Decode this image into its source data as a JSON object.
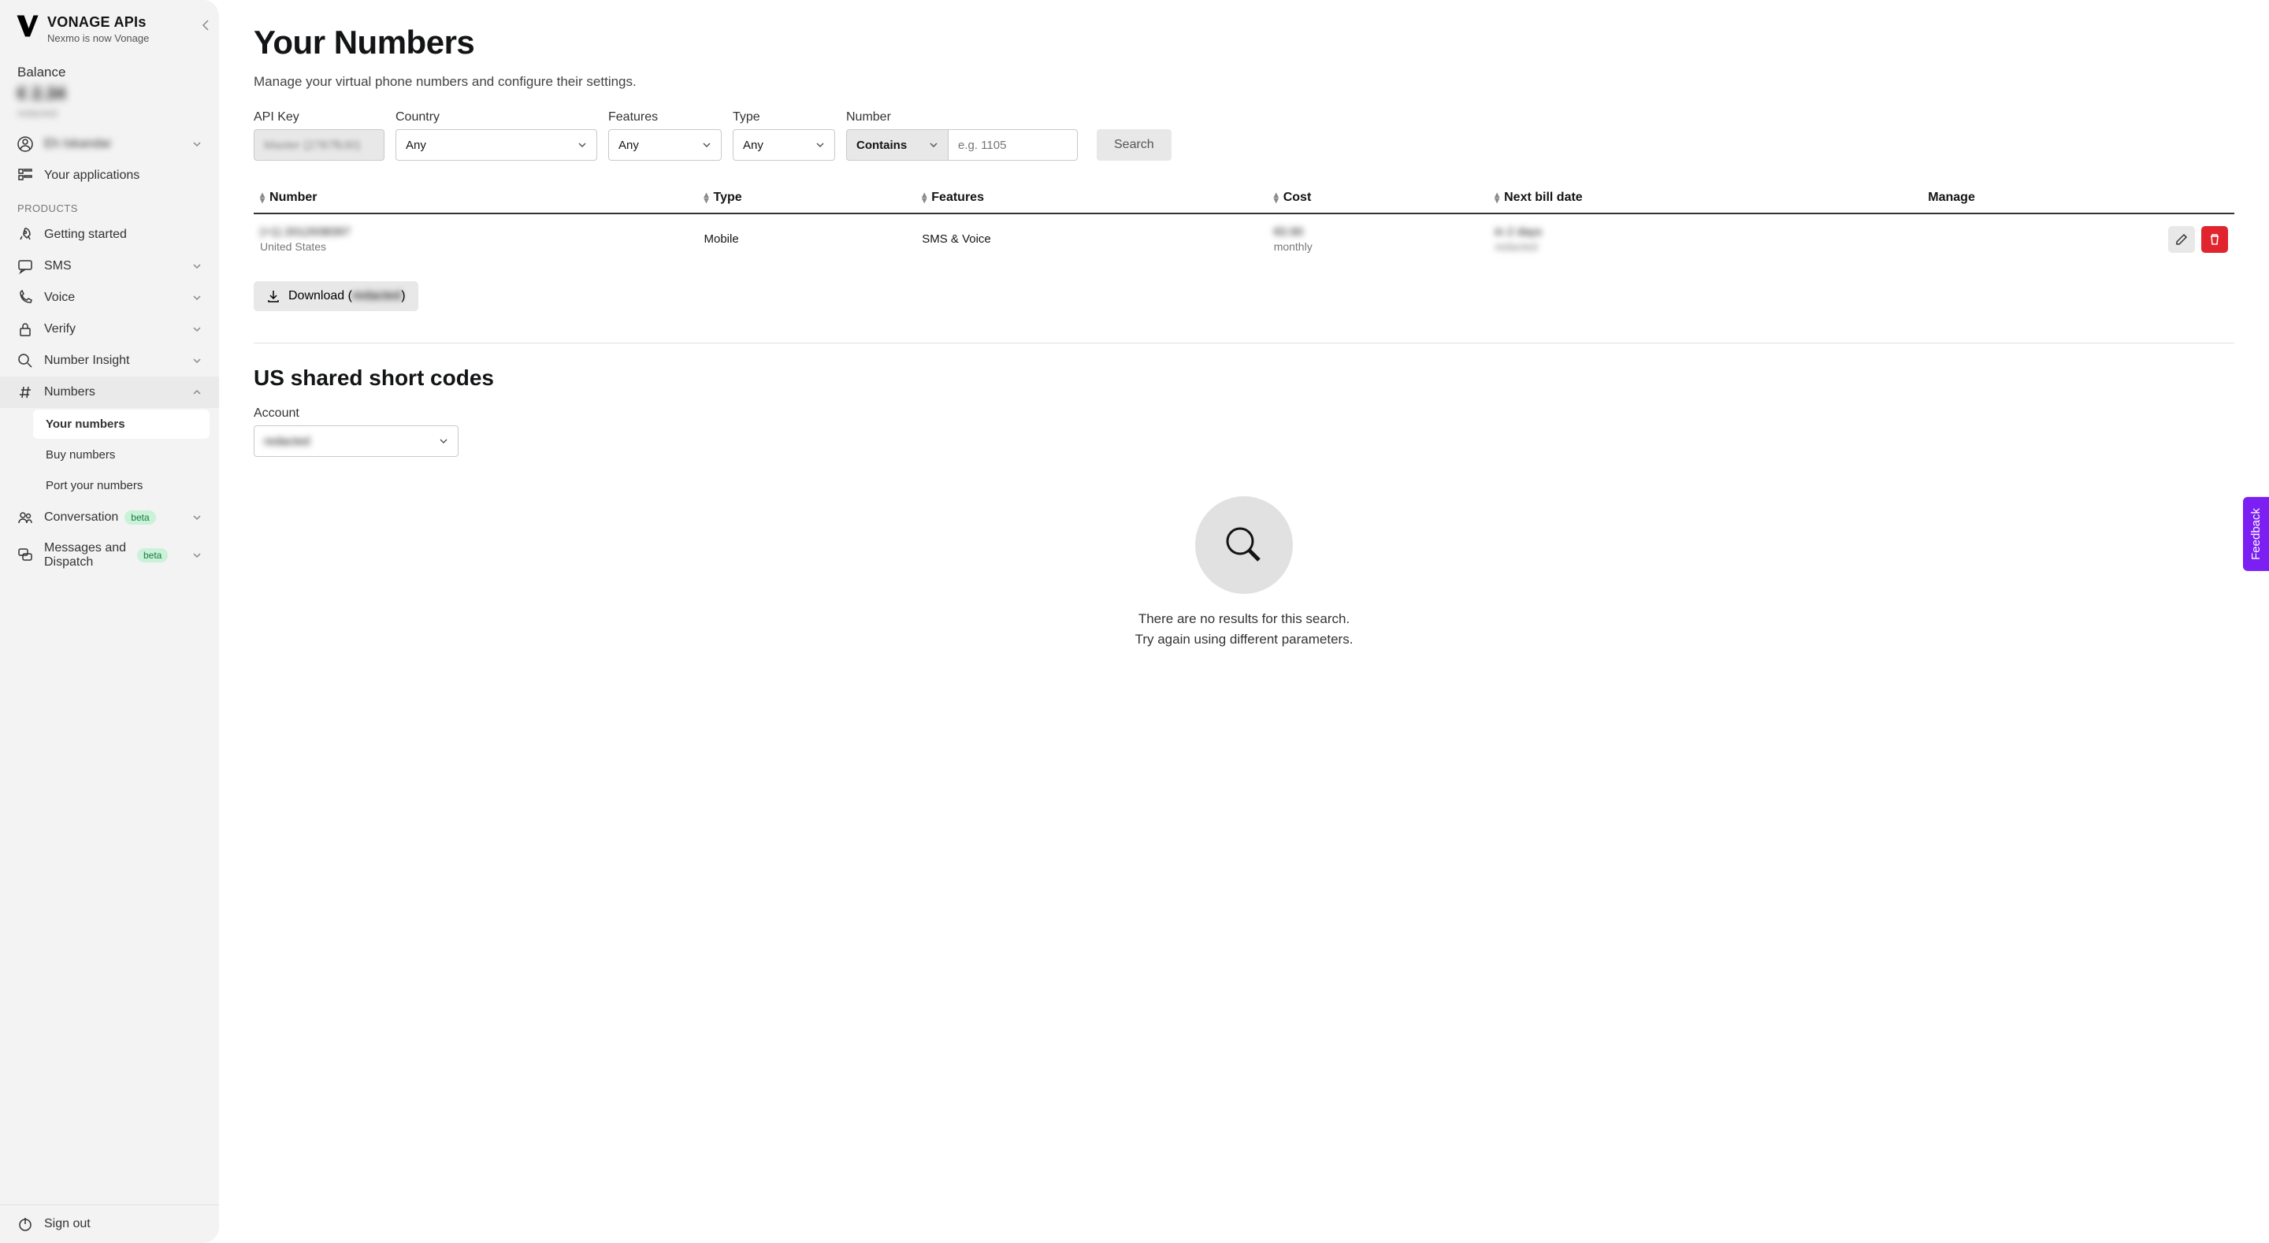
{
  "brand": {
    "title": "VONAGE APIs",
    "subtitle": "Nexmo is now Vonage"
  },
  "balance": {
    "label": "Balance",
    "amount": "€ 2.34",
    "sub": "redacted"
  },
  "user_item": "Eh Iskandar",
  "apps_item": "Your applications",
  "products_label": "PRODUCTS",
  "nav": {
    "getting_started": "Getting started",
    "sms": "SMS",
    "voice": "Voice",
    "verify": "Verify",
    "number_insight": "Number Insight",
    "numbers": "Numbers",
    "conversation": "Conversation",
    "messages_dispatch": "Messages and Dispatch",
    "sign_out": "Sign out"
  },
  "beta_label": "beta",
  "subnav": {
    "your_numbers": "Your numbers",
    "buy_numbers": "Buy numbers",
    "port_numbers": "Port your numbers"
  },
  "page": {
    "title": "Your Numbers",
    "desc": "Manage your virtual phone numbers and configure their settings."
  },
  "filters": {
    "api_key_label": "API Key",
    "api_key_value": "Master (2787fb30)",
    "country_label": "Country",
    "any": "Any",
    "features_label": "Features",
    "type_label": "Type",
    "number_label": "Number",
    "contains": "Contains",
    "number_placeholder": "e.g. 1105",
    "search": "Search"
  },
  "columns": {
    "number": "Number",
    "type": "Type",
    "features": "Features",
    "cost": "Cost",
    "next_bill": "Next bill date",
    "manage": "Manage"
  },
  "row": {
    "number": "(+1) 2012938397",
    "country": "United States",
    "type": "Mobile",
    "features": "SMS & Voice",
    "cost": "€0.90",
    "period": "monthly",
    "next_bill": "in 2 days",
    "next_bill_sub": "redacted"
  },
  "download": {
    "prefix": "Download (",
    "value": "redacted",
    "suffix": ")"
  },
  "shortcodes": {
    "title": "US shared short codes",
    "account_label": "Account",
    "account_value": "redacted",
    "empty1": "There are no results for this search.",
    "empty2": "Try again using different parameters."
  },
  "feedback": "Feedback"
}
